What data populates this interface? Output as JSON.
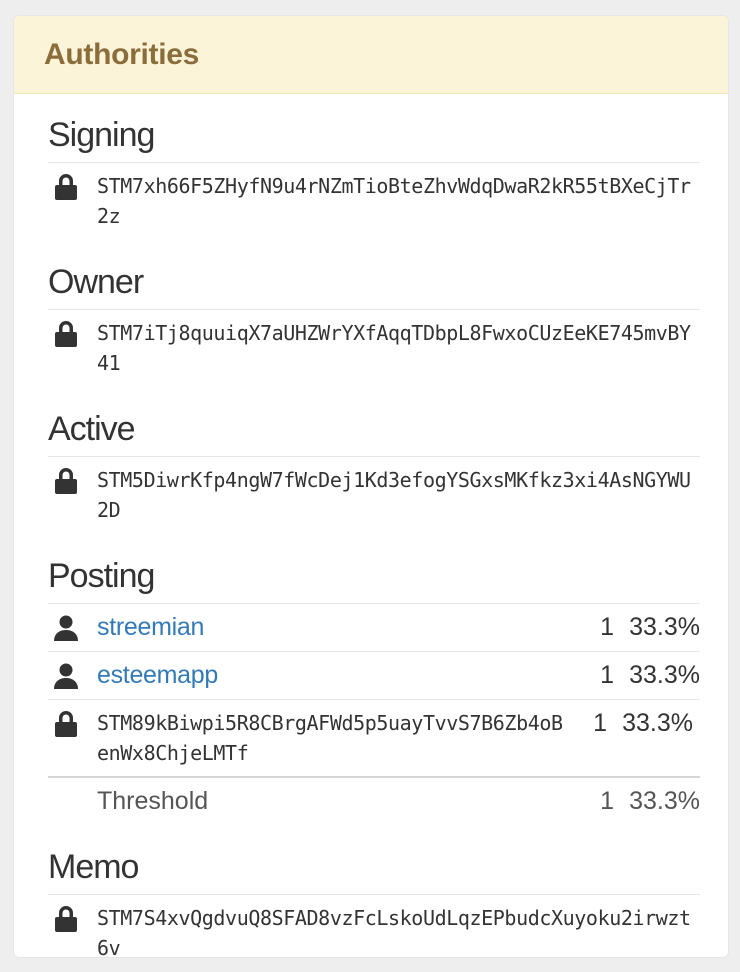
{
  "panel": {
    "title": "Authorities"
  },
  "colors": {
    "header_bg": "#fcf4d8",
    "title_color": "#8a6d3b",
    "link_color": "#337ab7"
  },
  "signing": {
    "title": "Signing",
    "key": "STM7xh66F5ZHyfN9u4rNZmTioBteZhvWdqDwaR2kR55tBXeCjTr2z",
    "icon": "lock-icon"
  },
  "owner": {
    "title": "Owner",
    "key": "STM7iTj8quuiqX7aUHZWrYXfAqqTDbpL8FwxoCUzEeKE745mvBY41",
    "icon": "lock-icon"
  },
  "active": {
    "title": "Active",
    "key": "STM5DiwrKfp4ngW7fWcDej1Kd3efogYSGxsMKfkz3xi4AsNGYWU2D",
    "icon": "lock-icon"
  },
  "posting": {
    "title": "Posting",
    "entries": [
      {
        "type": "account",
        "icon": "user-icon",
        "name": "streemian",
        "weight": "1",
        "percent": "33.3%"
      },
      {
        "type": "account",
        "icon": "user-icon",
        "name": "esteemapp",
        "weight": "1",
        "percent": "33.3%"
      },
      {
        "type": "key",
        "icon": "lock-icon",
        "name": "STM89kBiwpi5R8CBrgAFWd5p5uayTvvS7B6Zb4oBenWx8ChjeLMTf",
        "weight": "1",
        "percent": "33.3%"
      }
    ],
    "threshold": {
      "label": "Threshold",
      "weight": "1",
      "percent": "33.3%"
    }
  },
  "memo": {
    "title": "Memo",
    "key": "STM7S4xvQgdvuQ8SFAD8vzFcLskoUdLqzEPbudcXuyoku2irwzt6v",
    "icon": "lock-icon"
  }
}
